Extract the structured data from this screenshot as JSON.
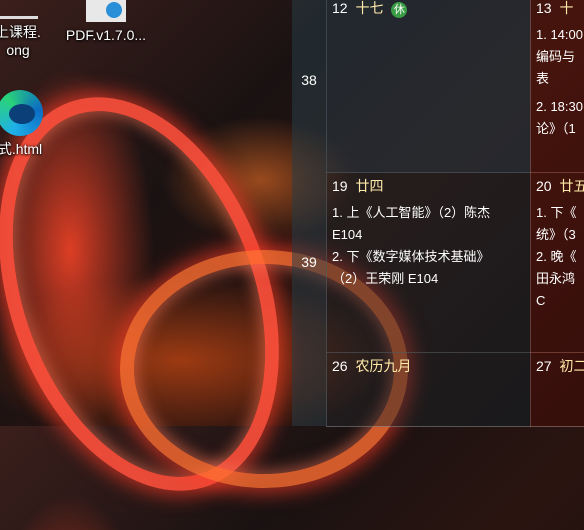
{
  "desktop": {
    "icons": [
      {
        "label_line1": "上课程.",
        "label_line2": "ong"
      },
      {
        "label_line1": "PDF.v1.7.0...",
        "label_line2": ""
      },
      {
        "label_line1": "式.html",
        "label_line2": ""
      }
    ]
  },
  "calendar": {
    "weeks": [
      {
        "number": "38"
      },
      {
        "number": "39"
      },
      {
        "number": ""
      }
    ],
    "days": [
      {
        "num": "12",
        "lunar": "十七",
        "badge": "休",
        "events": []
      },
      {
        "num": "13",
        "lunar": "十",
        "badge": "",
        "events": [
          "1. 14:00",
          "编码与表",
          "2. 18:30",
          "论》（1"
        ]
      },
      {
        "num": "19",
        "lunar": "廿四",
        "badge": "",
        "events": [
          "1. 上《人工智能》（2）陈杰",
          "E104",
          "2. 下《数字媒体技术基础》",
          "（2）王荣刚 E104"
        ]
      },
      {
        "num": "20",
        "lunar": "廿五",
        "badge": "",
        "events": [
          "1. 下《",
          "统》（3",
          "2. 晚《",
          "田永鸿C"
        ]
      },
      {
        "num": "26",
        "lunar": "农历九月",
        "badge": "",
        "events": []
      },
      {
        "num": "27",
        "lunar": "初二",
        "badge": "",
        "events": []
      }
    ]
  }
}
